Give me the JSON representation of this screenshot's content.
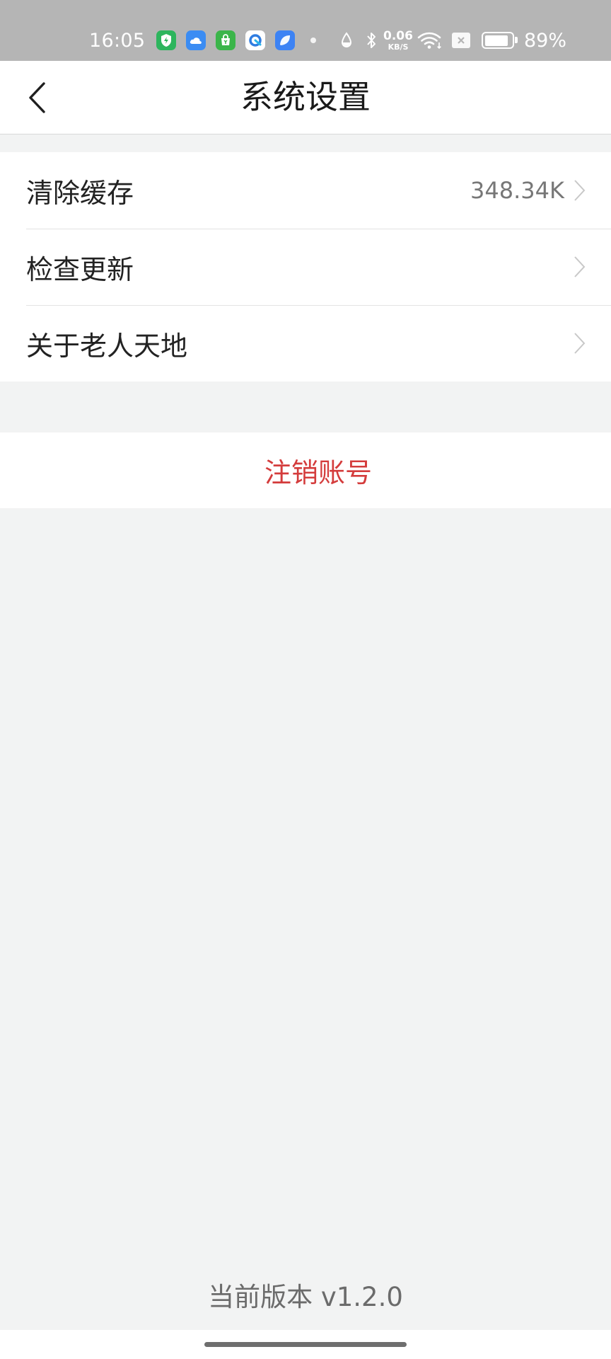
{
  "status_bar": {
    "time": "16:05",
    "notification_icons": [
      "security-app-icon",
      "weather-app-icon",
      "store-app-icon",
      "browser-app-icon",
      "notes-app-icon"
    ],
    "system_icons": [
      "notification-dot-icon",
      "water-drop-icon",
      "bluetooth-icon",
      "wifi-icon",
      "sim-off-icon",
      "battery-icon"
    ],
    "network_speed": {
      "value": "0.06",
      "unit": "KB/S"
    },
    "battery": {
      "level": 0.89,
      "label": "89%"
    }
  },
  "header": {
    "back_icon": "chevron-left-icon",
    "title": "系统设置"
  },
  "settings": {
    "items": [
      {
        "label": "清除缓存",
        "value": "348.34K",
        "icon": "chevron-right-icon"
      },
      {
        "label": "检查更新",
        "icon": "chevron-right-icon"
      },
      {
        "label": "关于老人天地",
        "icon": "chevron-right-icon"
      }
    ]
  },
  "logout": {
    "label": "注销账号"
  },
  "footer": {
    "version": "当前版本 v1.2.0"
  },
  "colors": {
    "status_bar_bg": "#b5b5b5",
    "page_bg": "#f2f3f3",
    "surface": "#ffffff",
    "text_primary": "#222222",
    "text_secondary": "#777777",
    "danger": "#d43c3c",
    "chevron": "#c8c8c8",
    "divider": "#e3e3e3"
  }
}
